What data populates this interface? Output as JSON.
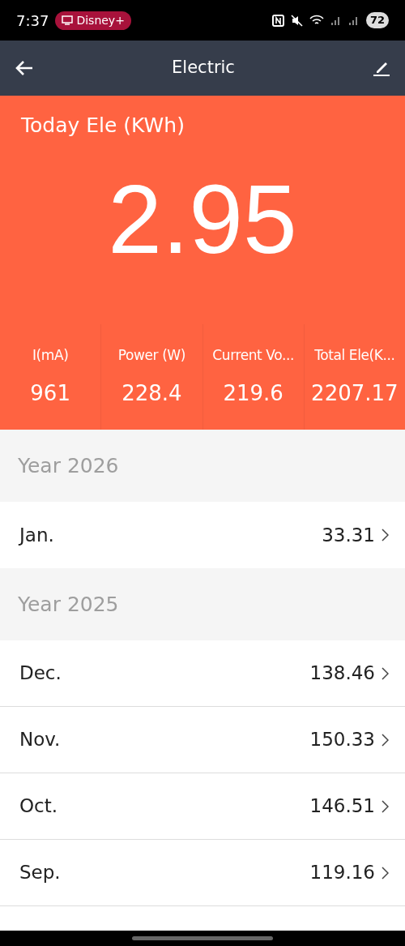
{
  "status_bar": {
    "time": "7:37",
    "app_chip": "Disney+",
    "battery": "72"
  },
  "app_bar": {
    "title": "Electric"
  },
  "today": {
    "label": "Today Ele (KWh)",
    "value": "2.95"
  },
  "stats": [
    {
      "label": "I(mA)",
      "value": "961"
    },
    {
      "label": "Power (W)",
      "value": "228.4"
    },
    {
      "label": "Current Vo...",
      "value": "219.6"
    },
    {
      "label": "Total Ele(K...",
      "value": "2207.17"
    }
  ],
  "years": [
    {
      "title": "Year 2026",
      "months": [
        {
          "month": "Jan.",
          "value": "33.31"
        }
      ]
    },
    {
      "title": "Year 2025",
      "months": [
        {
          "month": "Dec.",
          "value": "138.46"
        },
        {
          "month": "Nov.",
          "value": "150.33"
        },
        {
          "month": "Oct.",
          "value": "146.51"
        },
        {
          "month": "Sep.",
          "value": "119.16"
        }
      ]
    }
  ]
}
